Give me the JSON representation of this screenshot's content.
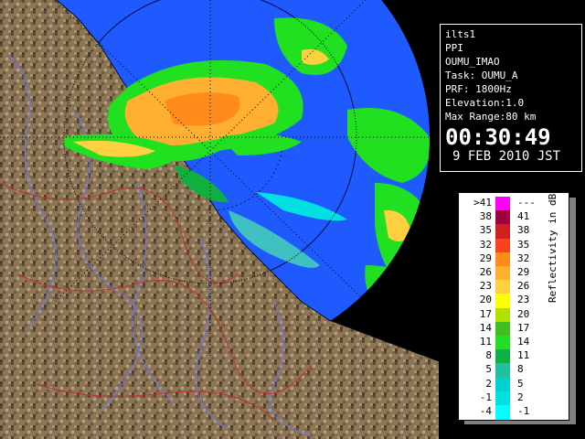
{
  "info": {
    "radar": "ilts1",
    "scan_type": "PPI",
    "site": "OUMU_IMAO",
    "task": "Task: OUMU_A",
    "prf": "PRF: 1800Hz",
    "elevation": "Elevation:1.0",
    "max_range": "Max Range:80 km",
    "time": "00:30:49",
    "date": "9 FEB 2010 JST"
  },
  "legend": {
    "unit": "Reflectivity in dBZ",
    "rows": [
      {
        "lo": ">41",
        "hi": "---",
        "color": "#ff00ff"
      },
      {
        "lo": "38",
        "hi": "41",
        "color": "#a00040"
      },
      {
        "lo": "35",
        "hi": "38",
        "color": "#d02020"
      },
      {
        "lo": "32",
        "hi": "35",
        "color": "#ff4020"
      },
      {
        "lo": "29",
        "hi": "32",
        "color": "#ff8c1a"
      },
      {
        "lo": "26",
        "hi": "29",
        "color": "#ffb030"
      },
      {
        "lo": "23",
        "hi": "26",
        "color": "#ffd040"
      },
      {
        "lo": "20",
        "hi": "23",
        "color": "#ffff00"
      },
      {
        "lo": "17",
        "hi": "20",
        "color": "#b0e000"
      },
      {
        "lo": "14",
        "hi": "17",
        "color": "#40c020"
      },
      {
        "lo": "11",
        "hi": "14",
        "color": "#20e020"
      },
      {
        "lo": "8",
        "hi": "11",
        "color": "#10b040"
      },
      {
        "lo": "5",
        "hi": "8",
        "color": "#20c0a0"
      },
      {
        "lo": "2",
        "hi": "5",
        "color": "#00d0d0"
      },
      {
        "lo": "-1",
        "hi": "2",
        "color": "#00e0e0"
      },
      {
        "lo": "-4",
        "hi": "-1",
        "color": "#00ffff"
      }
    ]
  },
  "colors": {
    "sea_range": "#1e5aff",
    "outer_range": "#2848e0",
    "land": "#8a7454",
    "river": "#6070ff",
    "border": "#c03030"
  }
}
